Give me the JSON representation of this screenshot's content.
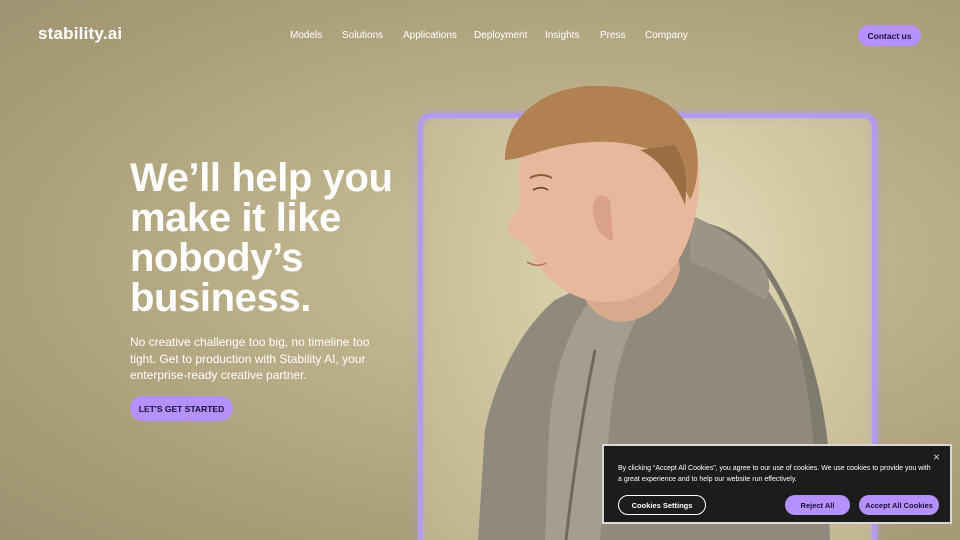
{
  "header": {
    "logo": "stability.ai",
    "nav": [
      "Models",
      "Solutions",
      "Applications",
      "Deployment",
      "Insights",
      "Press",
      "Company"
    ],
    "contact_label": "Contact us"
  },
  "hero": {
    "title": "We’ll help you make it like nobody’s business.",
    "subtitle": "No creative challenge too big, no timeline too tight. Get to production with Stability AI, your enterprise-ready creative partner.",
    "cta_label": "LET'S GET STARTED"
  },
  "cookie_banner": {
    "close_glyph": "×",
    "text": "By clicking “Accept All Cookies”, you agree to our use of cookies. We use cookies to provide you with a great experience and to help our website run effectively.",
    "settings_label": "Cookies Settings",
    "reject_label": "Reject All",
    "accept_label": "Accept All Cookies"
  },
  "colors": {
    "accent": "#b491ff",
    "background": "#b5aa84",
    "cookie_bg": "#1c1c1c"
  },
  "icons": [
    "close-icon"
  ]
}
